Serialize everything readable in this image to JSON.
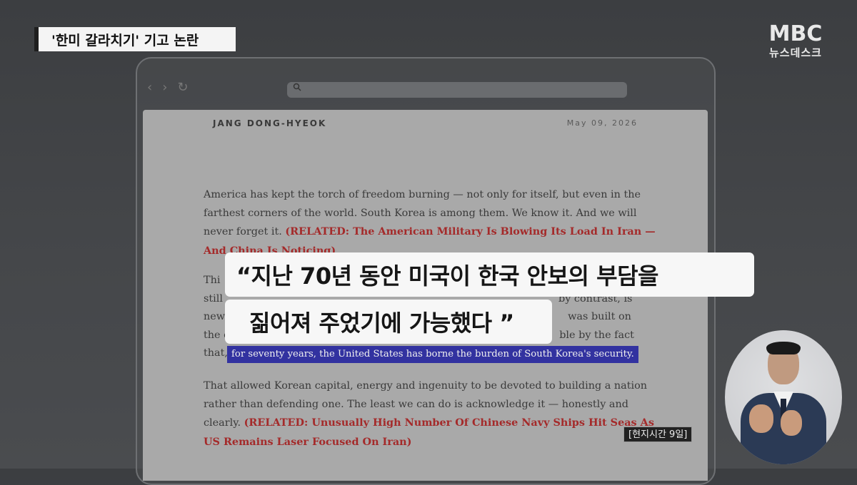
{
  "headline": "'한미 갈라치기' 기고 논란",
  "logo": {
    "line1": "MBC",
    "line2": "뉴스데스크"
  },
  "browser": {
    "nav": {
      "back": "‹",
      "forward": "›",
      "reload": "↻"
    }
  },
  "article": {
    "author": "JANG DONG-HYEOK",
    "date": "May 09, 2026",
    "p1_text": "America has kept the torch of freedom burning — not only for itself, but even in the farthest corners of the world. South Korea is among them. We know it. And we will never forget it. ",
    "p1_related": "(RELATED: The American Military Is Blowing Its Load In Iran — And China Is Noticing)",
    "p2_start": "Thi",
    "p2_line2": "still",
    "p2_mid": "by contrast, is",
    "p2_line3a": "new",
    "p2_line3b": "was built on",
    "p2_line4a": "the c",
    "p2_line4b": "ble by the fact",
    "p2_line5a": "that,",
    "highlight": "for seventy years, the United States has borne the burden of South Korea's security.",
    "p3_text": "That allowed Korean capital, energy and ingenuity to be devoted to building a nation rather than defending one. The least we can do is acknowledge it — honestly and clearly. ",
    "p3_related": "(RELATED: Unusually High Number Of Chinese Navy Ships Hit Seas As US Remains Laser Focused On Iran)"
  },
  "subtitle": {
    "line1": "“지난 70년 동안 미국이 한국 안보의 부담을",
    "line2": "짊어져 주었기에 가능했다 ”"
  },
  "time_tag": "[현지시간 9일]"
}
